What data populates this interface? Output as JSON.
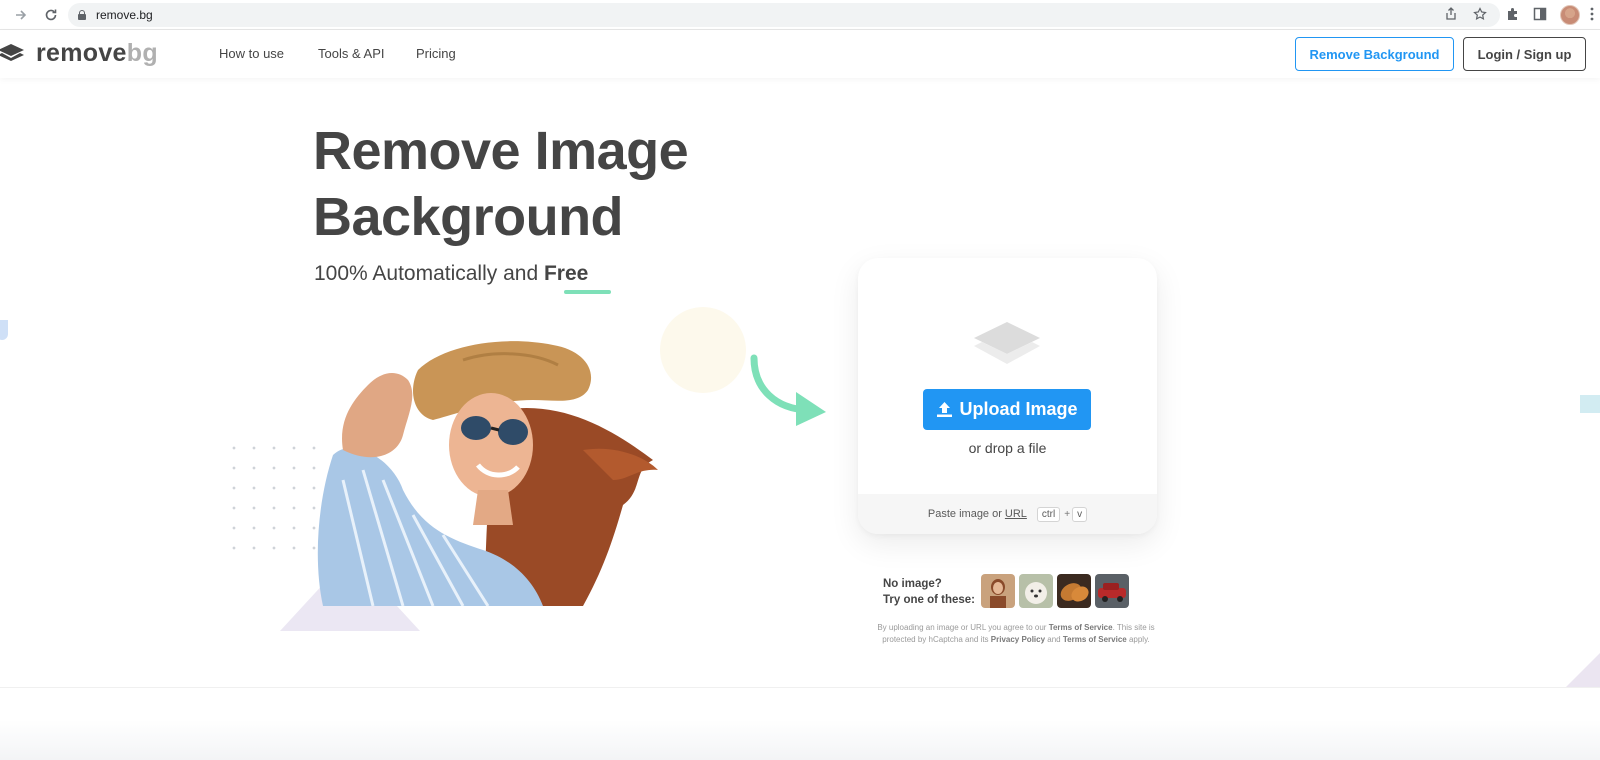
{
  "browser": {
    "url": "remove.bg",
    "back_icon": "arrow-right-icon",
    "reload_icon": "reload-icon"
  },
  "header": {
    "logo_main": "remove",
    "logo_suffix": "bg",
    "nav": [
      "How to use",
      "Tools & API",
      "Pricing"
    ],
    "remove_bg_button": "Remove Background",
    "login_button": "Login / Sign up"
  },
  "hero": {
    "title_line1": "Remove Image",
    "title_line2": "Background",
    "subtitle_prefix": "100% Automatically and ",
    "subtitle_free": "Free"
  },
  "upload": {
    "button_label": "Upload Image",
    "drop_text": "or drop a file",
    "paste_text": "Paste image or",
    "url_link": "URL",
    "kbd_ctrl": "ctrl",
    "kbd_plus": "+",
    "kbd_v": "v"
  },
  "samples": {
    "line1": "No image?",
    "line2": "Try one of these:"
  },
  "legal": {
    "t1": "By uploading an image or URL you agree to our ",
    "tos1": "Terms of Service",
    "t2": ". This site is protected by hCaptcha and its ",
    "privacy": "Privacy Policy",
    "t3": " and ",
    "tos2": "Terms of Service",
    "t4": " apply."
  },
  "colors": {
    "accent_blue": "#2196f3",
    "text_dark": "#454545",
    "mint": "#7ee0b8"
  }
}
